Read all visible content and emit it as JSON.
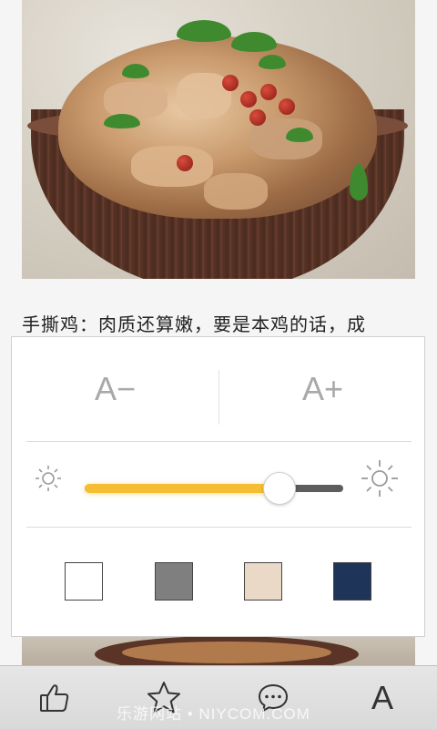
{
  "article": {
    "text_line": "手撕鸡：肉质还算嫩，要是本鸡的话，成"
  },
  "reading_settings": {
    "font_size": {
      "decrease_label": "A−",
      "increase_label": "A+"
    },
    "brightness": {
      "level": 0.79,
      "low_icon": "sun-small-icon",
      "high_icon": "sun-large-icon",
      "fill_color": "#f5bd31"
    },
    "themes": [
      {
        "name": "white",
        "color": "#ffffff"
      },
      {
        "name": "gray",
        "color": "#7f7f7f"
      },
      {
        "name": "beige",
        "color": "#e9d9c6"
      },
      {
        "name": "navy",
        "color": "#1e3559"
      }
    ]
  },
  "toolbar": {
    "items": [
      {
        "icon": "thumbs-up-icon"
      },
      {
        "icon": "star-icon"
      },
      {
        "icon": "comment-icon"
      },
      {
        "icon": "font-icon",
        "label": "A"
      }
    ],
    "watermark": "乐游网站 • NIYCOM.COM"
  },
  "colors": {
    "accent": "#f5bd31",
    "track": "#5d5d5d"
  }
}
